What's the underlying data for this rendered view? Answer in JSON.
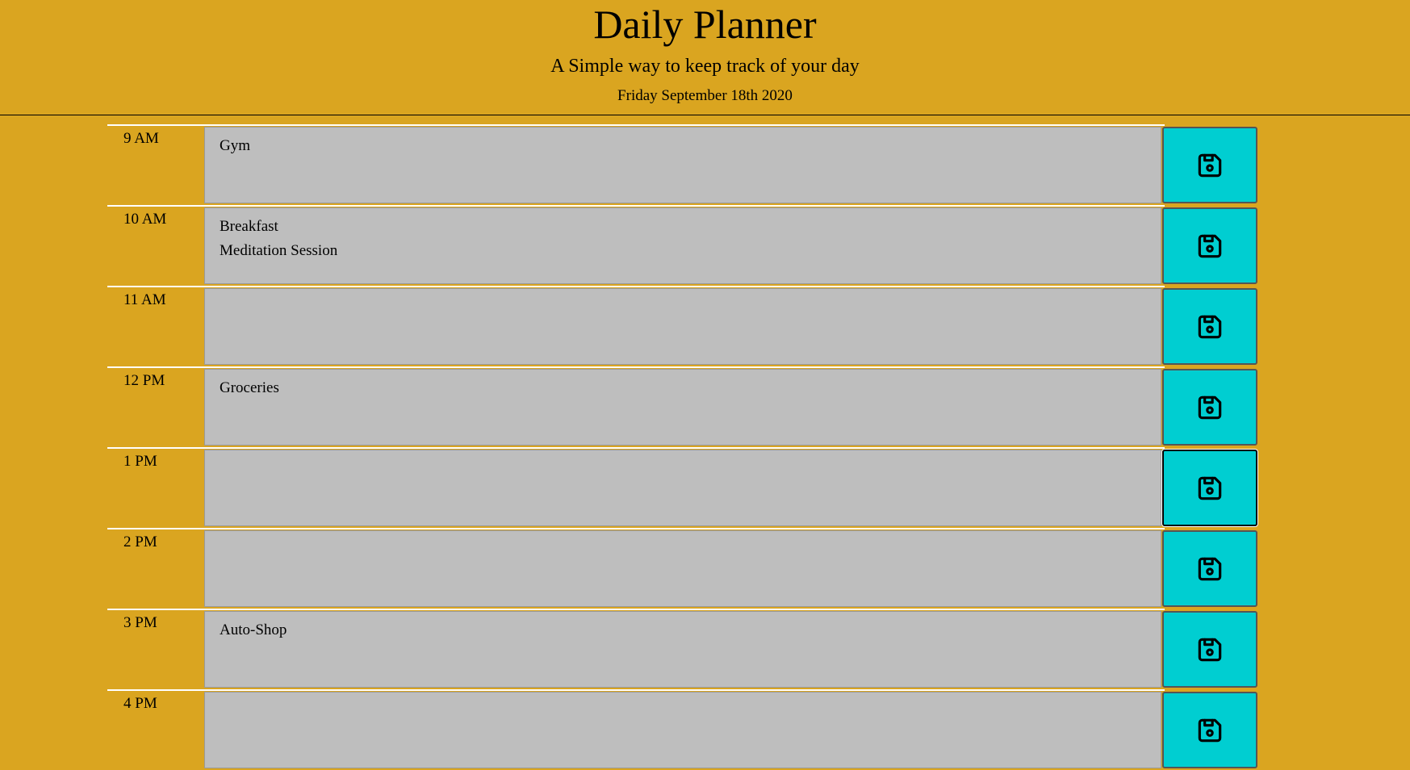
{
  "header": {
    "title": "Daily Planner",
    "subtitle": "A Simple way to keep track of your day",
    "date": "Friday September 18th 2020"
  },
  "colors": {
    "background": "#DAA520",
    "task_background": "#BEBEBE",
    "save_button": "#00CED1"
  },
  "rows": [
    {
      "hour": "9 AM",
      "task": "Gym",
      "save_icon": "floppy-disk-icon"
    },
    {
      "hour": "10 AM",
      "task": "Breakfast\nMeditation Session",
      "save_icon": "floppy-disk-icon"
    },
    {
      "hour": "11 AM",
      "task": "",
      "save_icon": "floppy-disk-icon"
    },
    {
      "hour": "12 PM",
      "task": "Groceries",
      "save_icon": "floppy-disk-icon"
    },
    {
      "hour": "1 PM",
      "task": "",
      "save_icon": "floppy-disk-icon"
    },
    {
      "hour": "2 PM",
      "task": "",
      "save_icon": "floppy-disk-icon"
    },
    {
      "hour": "3 PM",
      "task": "Auto-Shop",
      "save_icon": "floppy-disk-icon"
    },
    {
      "hour": "4 PM",
      "task": "",
      "save_icon": "floppy-disk-icon"
    }
  ]
}
